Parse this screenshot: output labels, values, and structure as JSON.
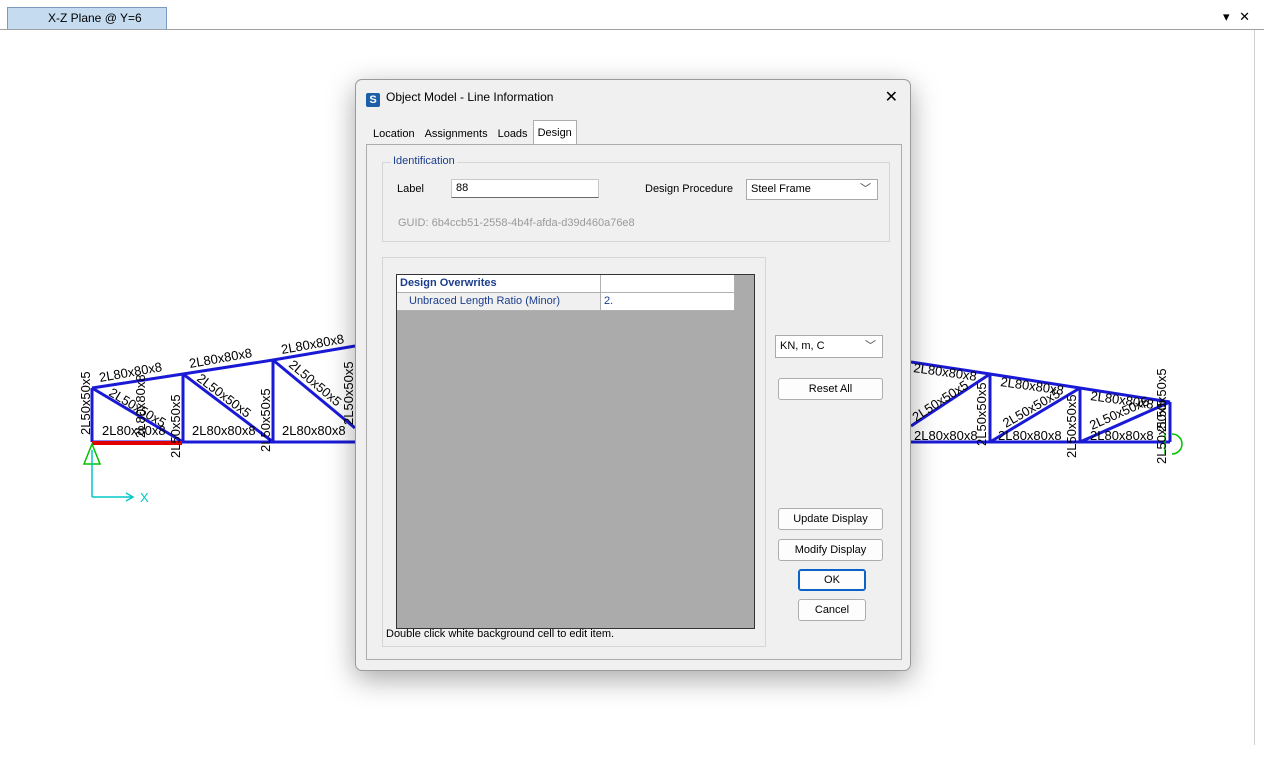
{
  "window": {
    "view_tab": "X-Z Plane @ Y=6",
    "controls": [
      "▾",
      "✕"
    ]
  },
  "model": {
    "axis_label": "X",
    "left_labels": [
      "2L50x50x5",
      "2L80x80x8",
      "2L50x50x5",
      "2L80x80x8",
      "2L50x50x5",
      "2L80x80x8",
      "2L50x50x5",
      "2L80x80x8",
      "2L50x50x5",
      "2L80x80x8",
      "2L80x80x8",
      "2L50x50x5",
      "2L50x50x5",
      "2L80x80x8"
    ],
    "right_labels": [
      "2L80x80x8",
      "2L50x50x5",
      "2L80x80x8",
      "2L50x50x5",
      "2L80x80x8",
      "2L80x80x8",
      "2L50x50x5",
      "2L80x80x8",
      "2L50x50x5",
      "2L50x50x5",
      "2L80x80x8",
      "2L50x50x5",
      "2L50x50x5"
    ],
    "colors": {
      "member": "#1a1ad6",
      "selected": "#e00000",
      "support": "#00c000",
      "axis": "#00c8c8"
    }
  },
  "dialog": {
    "app_icon": "S",
    "title": "Object Model - Line Information",
    "tabs": [
      "Location",
      "Assignments",
      "Loads",
      "Design"
    ],
    "active_tab": "Design",
    "identification": {
      "legend": "Identification",
      "label_caption": "Label",
      "label_value": "88",
      "procedure_caption": "Design Procedure",
      "procedure_value": "Steel Frame",
      "guid": "GUID:  6b4ccb51-2558-4b4f-afda-d39d460a76e8"
    },
    "overwrites": {
      "header": "Design Overwrites",
      "rows": [
        {
          "name": "Unbraced Length Ratio (Minor)",
          "value": "2."
        }
      ]
    },
    "hint": "Double click white background cell to edit item.",
    "units_value": "KN, m, C",
    "buttons": {
      "reset_all": "Reset All",
      "update_display": "Update Display",
      "modify_display": "Modify Display",
      "ok": "OK",
      "cancel": "Cancel"
    }
  }
}
